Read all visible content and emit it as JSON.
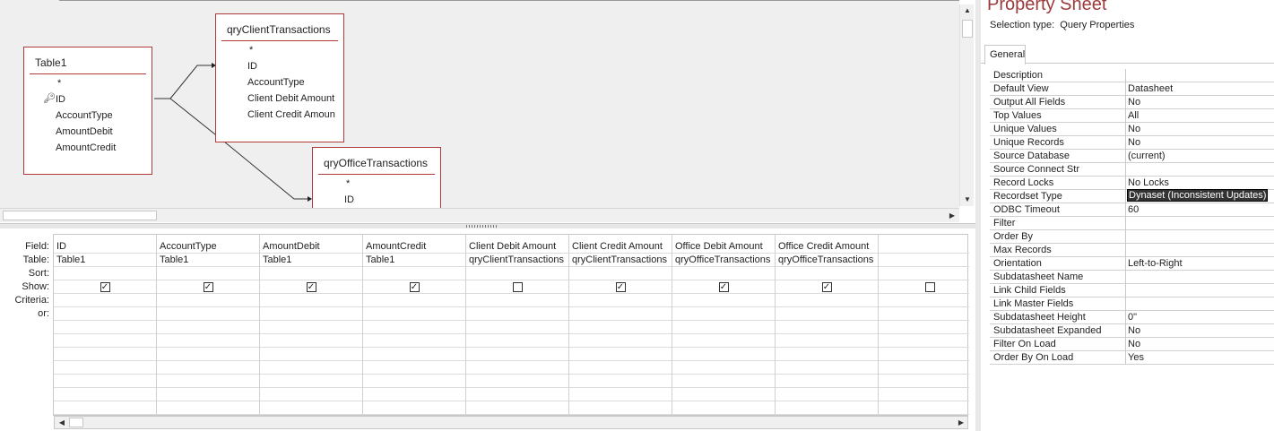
{
  "query_design": {
    "tables": [
      {
        "name": "Table1",
        "fields": [
          "*",
          "ID",
          "AccountType",
          "AmountDebit",
          "AmountCredit"
        ],
        "key_field": "ID"
      },
      {
        "name": "qryClientTransactions",
        "fields": [
          "*",
          "ID",
          "AccountType",
          "Client Debit Amount",
          "Client Credit Amoun"
        ]
      },
      {
        "name": "qryOfficeTransactions",
        "fields": [
          "*",
          "ID"
        ]
      }
    ]
  },
  "grid": {
    "row_labels": [
      "Field:",
      "Table:",
      "Sort:",
      "Show:",
      "Criteria:",
      "or:"
    ],
    "columns": [
      {
        "field": "ID",
        "table": "Table1",
        "show": true
      },
      {
        "field": "AccountType",
        "table": "Table1",
        "show": true
      },
      {
        "field": "AmountDebit",
        "table": "Table1",
        "show": true
      },
      {
        "field": "AmountCredit",
        "table": "Table1",
        "show": true
      },
      {
        "field": "Client Debit Amount",
        "table": "qryClientTransactions",
        "show": false
      },
      {
        "field": "Client Credit Amount",
        "table": "qryClientTransactions",
        "show": true
      },
      {
        "field": "Office Debit Amount",
        "table": "qryOfficeTransactions",
        "show": true
      },
      {
        "field": "Office Credit Amount",
        "table": "qryOfficeTransactions",
        "show": true
      },
      {
        "field": "",
        "table": "",
        "show": false
      }
    ]
  },
  "property_sheet": {
    "title": "Property Sheet",
    "selection_type_label": "Selection type:",
    "selection_type_value": "Query Properties",
    "tab_general": "General",
    "properties": [
      {
        "label": "Description",
        "value": ""
      },
      {
        "label": "Default View",
        "value": "Datasheet"
      },
      {
        "label": "Output All Fields",
        "value": "No"
      },
      {
        "label": "Top Values",
        "value": "All"
      },
      {
        "label": "Unique Values",
        "value": "No"
      },
      {
        "label": "Unique Records",
        "value": "No"
      },
      {
        "label": "Source Database",
        "value": "(current)"
      },
      {
        "label": "Source Connect Str",
        "value": ""
      },
      {
        "label": "Record Locks",
        "value": "No Locks"
      },
      {
        "label": "Recordset Type",
        "value": "Dynaset (Inconsistent Updates)"
      },
      {
        "label": "ODBC Timeout",
        "value": "60"
      },
      {
        "label": "Filter",
        "value": ""
      },
      {
        "label": "Order By",
        "value": ""
      },
      {
        "label": "Max Records",
        "value": ""
      },
      {
        "label": "Orientation",
        "value": "Left-to-Right"
      },
      {
        "label": "Subdatasheet Name",
        "value": ""
      },
      {
        "label": "Link Child Fields",
        "value": ""
      },
      {
        "label": "Link Master Fields",
        "value": ""
      },
      {
        "label": "Subdatasheet Height",
        "value": "0\""
      },
      {
        "label": "Subdatasheet Expanded",
        "value": "No"
      },
      {
        "label": "Filter On Load",
        "value": "No"
      },
      {
        "label": "Order By On Load",
        "value": "Yes"
      }
    ],
    "selected_property": "Recordset Type"
  },
  "colors": {
    "table_border": "#b03a3a",
    "title_accent": "#9b3a3a",
    "selection": "#333333"
  }
}
